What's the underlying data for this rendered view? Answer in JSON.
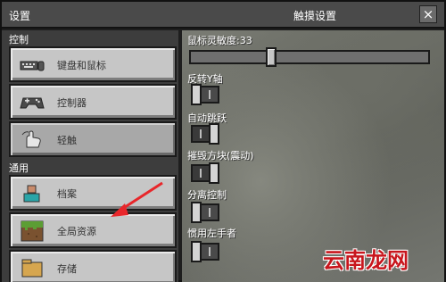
{
  "window": {
    "title_left": "设置",
    "title_center": "触摸设置",
    "close_label": "×"
  },
  "sidebar": {
    "section_control": "控制",
    "section_general": "通用",
    "items": [
      {
        "label": "键盘和鼠标",
        "icon": "keyboard-mouse-icon"
      },
      {
        "label": "控制器",
        "icon": "gamepad-icon"
      },
      {
        "label": "轻触",
        "icon": "touch-hand-icon",
        "selected": true
      },
      {
        "label": "档案",
        "icon": "profile-icon"
      },
      {
        "label": "全局资源",
        "icon": "grass-block-icon"
      },
      {
        "label": "存储",
        "icon": "storage-icon"
      }
    ]
  },
  "settings": {
    "sensitivity_label": "鼠标灵敏度:33",
    "sensitivity_value": 33,
    "invert_y_label": "反转Y轴",
    "invert_y": false,
    "auto_jump_label": "自动跳跃",
    "auto_jump": true,
    "destroy_block_label": "摧毁方块(震动)",
    "destroy_block": true,
    "split_controls_label": "分离控制",
    "split_controls": false,
    "left_handed_label": "惯用左手者",
    "left_handed": false
  },
  "watermark": "云南龙网",
  "colors": {
    "button_face": "#c6c6c6",
    "panel_bg": "#3d3d3d",
    "title_bar": "#4a4a4a",
    "arrow": "#e8262a",
    "watermark": "#c8161d"
  }
}
